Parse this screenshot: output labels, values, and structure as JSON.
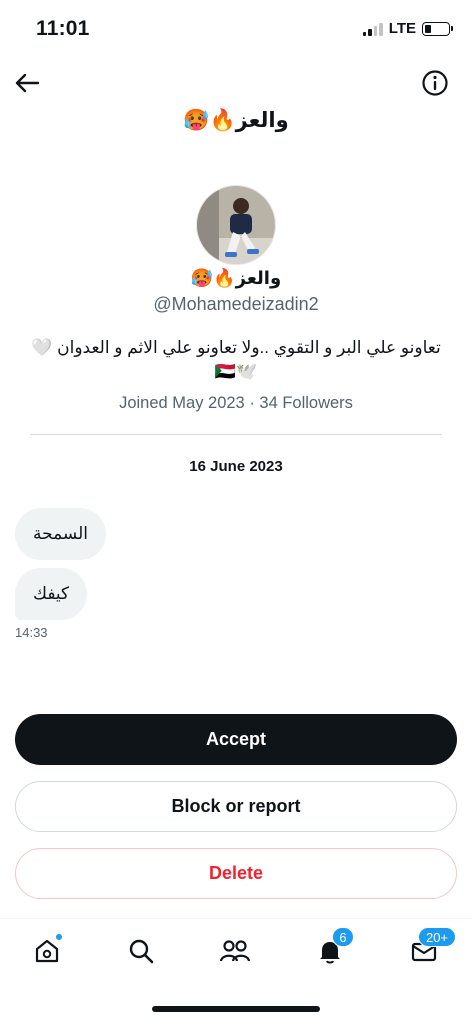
{
  "status_bar": {
    "time": "11:01",
    "network": "LTE"
  },
  "header": {
    "title": "والعز🔥🥵"
  },
  "profile": {
    "name": "والعز🔥🥵",
    "handle": "@Mohamedeizadin2",
    "bio": "تعاونو علي البر و التقوي ..ولا تعاونو علي الاثم و العدوان 🤍🕊️🇸🇩",
    "meta": "Joined May 2023 · 34 Followers"
  },
  "conversation": {
    "date": "16 June 2023",
    "messages": [
      {
        "text": "السمحة"
      },
      {
        "text": "كيفك"
      }
    ],
    "last_time": "14:33"
  },
  "actions": {
    "accept": "Accept",
    "block": "Block or report",
    "delete": "Delete"
  },
  "tabbar": {
    "notifications_badge": "6",
    "messages_badge": "20+"
  },
  "colors": {
    "accent": "#1d9bf0",
    "danger": "#f4212e",
    "primary_text": "#0f1419",
    "secondary_text": "#536471",
    "bubble": "#eff3f4"
  },
  "icons": {
    "back": "arrow-left-icon",
    "info": "info-circle-icon",
    "home": "home-icon",
    "search": "search-icon",
    "communities": "communities-icon",
    "notifications": "bell-icon",
    "messages": "envelope-icon"
  }
}
